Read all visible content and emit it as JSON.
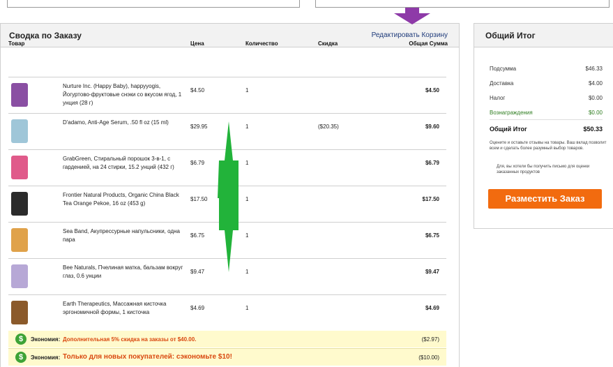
{
  "summary": {
    "title": "Сводка по Заказу",
    "edit_link": "Редактировать Корзину",
    "columns": {
      "product": "Товар",
      "price": "Цена",
      "qty": "Количество",
      "discount": "Скидка",
      "total": "Общая Сумма"
    },
    "items": [
      {
        "name": "Nurture Inc. (Happy Baby), happyyogis, Йогуртово-фруктовые снэки со вкусом ягод, 1 унция (28 г)",
        "price": "$4.50",
        "qty": "1",
        "discount": "",
        "total": "$4.50",
        "thumb_color": "#8a4fa3"
      },
      {
        "name": "D'adamo, Anti-Age Serum, .50 fl oz (15 ml)",
        "price": "$29.95",
        "qty": "1",
        "discount": "($20.35)",
        "total": "$9.60",
        "thumb_color": "#9fc6d8"
      },
      {
        "name": "GrabGreen, Стиральный порошок 3-в-1, с гарденией, на 24 стирки, 15.2 унций (432 г)",
        "price": "$6.79",
        "qty": "1",
        "discount": "",
        "total": "$6.79",
        "thumb_color": "#e05a8a"
      },
      {
        "name": "Frontier Natural Products, Organic China Black Tea Orange Pekoe, 16 oz (453 g)",
        "price": "$17.50",
        "qty": "1",
        "discount": "",
        "total": "$17.50",
        "thumb_color": "#2b2b2b"
      },
      {
        "name": "Sea Band, Акупрессурные напульсники, одна пара",
        "price": "$6.75",
        "qty": "1",
        "discount": "",
        "total": "$6.75",
        "thumb_color": "#e0a24a"
      },
      {
        "name": "Bee Naturals, Пчелиная матка, бальзам вокруг глаз, 0.6 унции",
        "price": "$9.47",
        "qty": "1",
        "discount": "",
        "total": "$9.47",
        "thumb_color": "#b7a8d6"
      },
      {
        "name": "Earth Therapeutics, Массажная кисточка эргономичной формы, 1 кисточка",
        "price": "$4.69",
        "qty": "1",
        "discount": "",
        "total": "$4.69",
        "thumb_color": "#8b5a2b"
      }
    ],
    "savings": [
      {
        "label": "Экономия:",
        "text": "Дополнительная 5% скидка на заказы от $40.00.",
        "amount": "($2.97)"
      },
      {
        "label": "Экономия:",
        "text": "Только для новых покупателей: сэкономьте $10!",
        "amount": "($10.00)"
      }
    ]
  },
  "totals": {
    "title": "Общий Итог",
    "subtotal_label": "Подсумма",
    "subtotal": "$46.33",
    "shipping_label": "Доставка",
    "shipping": "$4.00",
    "tax_label": "Налог",
    "tax": "$0.00",
    "rewards_label": "Вознаграждения",
    "rewards": "$0.00",
    "grand_label": "Общий Итог",
    "grand": "$50.33",
    "note1": "Оцените и оставьте отзывы на товары. Ваш вклад позволит всем и сделать более разумный выбор товаров.",
    "note2": "Для, вы хотели бы получить письмо для оценки заказанных продуктов",
    "place_order": "Разместить Заказ",
    "rewards_color": "#2e7d1f",
    "button_color": "#f26b0f"
  },
  "annotations": {
    "arrow_top_color": "#8e3aa8",
    "arrow_mid_color": "#22b33a"
  }
}
